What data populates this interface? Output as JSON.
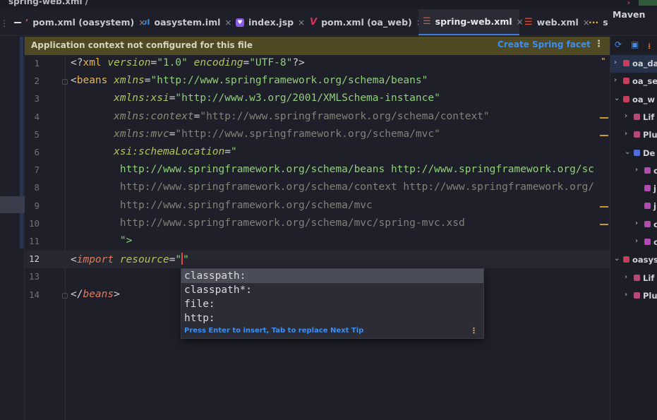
{
  "breadcrumb": {
    "file": "spring-web.xml",
    "separator": "/"
  },
  "tabs": [
    {
      "label": "pom.xml (oasystem)",
      "icon": "maven-pom-icon",
      "active": false
    },
    {
      "label": "oasystem.iml",
      "icon": "iml-module-icon",
      "active": false
    },
    {
      "label": "index.jsp",
      "icon": "jsp-file-icon",
      "active": false
    },
    {
      "label": "pom.xml (oa_web)",
      "icon": "maven-v-icon",
      "active": false
    },
    {
      "label": "spring-web.xml",
      "icon": "spring-xml-icon",
      "active": true
    },
    {
      "label": "web.xml",
      "icon": "xml-file-icon",
      "active": false
    }
  ],
  "tab_close_glyph": "×",
  "tab_overflow": "s",
  "maven_panel": {
    "title": "Maven",
    "rows": [
      {
        "label": "oa_da",
        "selected": true,
        "chevron": "›"
      },
      {
        "label": "oa_se",
        "selected": false,
        "chevron": "›"
      },
      {
        "label": "oa_w",
        "selected": false,
        "chevron": "⌄"
      },
      {
        "label": "Lif",
        "selected": false,
        "chevron": "›"
      },
      {
        "label": "Plu",
        "selected": false,
        "chevron": "›"
      },
      {
        "label": "De",
        "selected": false,
        "chevron": "⌄"
      },
      {
        "label": "c",
        "selected": false,
        "chevron": "›"
      },
      {
        "label": "j",
        "selected": false,
        "chevron": ""
      },
      {
        "label": "j",
        "selected": false,
        "chevron": ""
      },
      {
        "label": "c",
        "selected": false,
        "chevron": "›"
      },
      {
        "label": "c",
        "selected": false,
        "chevron": "›"
      },
      {
        "label": "oasys",
        "selected": false,
        "chevron": "⌄"
      },
      {
        "label": "Lif",
        "selected": false,
        "chevron": "›"
      },
      {
        "label": "Plu",
        "selected": false,
        "chevron": "›"
      }
    ]
  },
  "banner": {
    "message": "Application context not configured for this file",
    "action": "Create Spring facet",
    "more": "⋮"
  },
  "editor": {
    "current_line": 12,
    "lines": [
      {
        "n": "1",
        "parts": [
          [
            "c-pi",
            "<?"
          ],
          [
            "c-tag",
            "xml "
          ],
          [
            "c-attr",
            "version"
          ],
          [
            "c-punct",
            "="
          ],
          [
            "c-str",
            "\"1.0\" "
          ],
          [
            "c-attr",
            "encoding"
          ],
          [
            "c-punct",
            "="
          ],
          [
            "c-str",
            "\"UTF-8\""
          ],
          [
            "c-pi",
            "?>"
          ]
        ]
      },
      {
        "n": "2",
        "parts": [
          [
            "c-punct",
            "<"
          ],
          [
            "c-tag",
            "beans "
          ],
          [
            "c-attr",
            "xmlns"
          ],
          [
            "c-punct",
            "="
          ],
          [
            "c-str",
            "\"http://www.springframework.org/schema/beans\""
          ]
        ]
      },
      {
        "n": "3",
        "parts": [
          [
            "c-punct",
            "       "
          ],
          [
            "c-attr",
            "xmlns:xsi"
          ],
          [
            "c-punct",
            "="
          ],
          [
            "c-str",
            "\"http://www.w3.org/2001/XMLSchema-instance\""
          ]
        ]
      },
      {
        "n": "4",
        "parts": [
          [
            "c-punct",
            "       "
          ],
          [
            "c-attr-dim",
            "xmlns:context"
          ],
          [
            "c-punct",
            "="
          ],
          [
            "c-str-dim",
            "\"http://www.springframework.org/schema/context\""
          ]
        ]
      },
      {
        "n": "5",
        "parts": [
          [
            "c-punct",
            "       "
          ],
          [
            "c-attr-dim",
            "xmlns:mvc"
          ],
          [
            "c-punct",
            "="
          ],
          [
            "c-str-dim",
            "\"http://www.springframework.org/schema/mvc\""
          ]
        ]
      },
      {
        "n": "6",
        "parts": [
          [
            "c-punct",
            "       "
          ],
          [
            "c-attr",
            "xsi:schemaLocation"
          ],
          [
            "c-punct",
            "="
          ],
          [
            "c-str",
            "\""
          ]
        ]
      },
      {
        "n": "7",
        "parts": [
          [
            "c-str",
            "        http://www.springframework.org/schema/beans http://www.springframework.org/sc"
          ]
        ]
      },
      {
        "n": "8",
        "parts": [
          [
            "c-str-dim",
            "        http://www.springframework.org/schema/context http://www.springframework.org/"
          ]
        ]
      },
      {
        "n": "9",
        "parts": [
          [
            "c-str-dim",
            "        http://www.springframework.org/schema/mvc"
          ]
        ]
      },
      {
        "n": "10",
        "parts": [
          [
            "c-str-dim",
            "        http://www.springframework.org/schema/mvc/spring-mvc.xsd"
          ]
        ]
      },
      {
        "n": "11",
        "parts": [
          [
            "c-str",
            "        \">"
          ]
        ]
      },
      {
        "n": "12",
        "parts": [
          [
            "c-punct",
            "<"
          ],
          [
            "c-kw",
            "import "
          ],
          [
            "c-attr",
            "resource"
          ],
          [
            "c-punct",
            "="
          ],
          [
            "c-str",
            "\""
          ],
          [
            "caret",
            ""
          ],
          [
            "c-str",
            "\""
          ]
        ]
      },
      {
        "n": "13",
        "parts": []
      },
      {
        "n": "14",
        "parts": [
          [
            "c-punct",
            "</"
          ],
          [
            "c-kw",
            "beans"
          ],
          [
            "c-punct",
            ">"
          ]
        ]
      }
    ]
  },
  "completion": {
    "items": [
      "classpath:",
      "classpath*:",
      "file:",
      "http:"
    ],
    "selected_index": 0,
    "tip": "Press Enter to insert, Tab to replace  Next Tip",
    "more": "⋮"
  },
  "colors": {
    "accent": "#3e79d9",
    "banner_bg": "#4f4a24",
    "link": "#3d8ef0"
  }
}
